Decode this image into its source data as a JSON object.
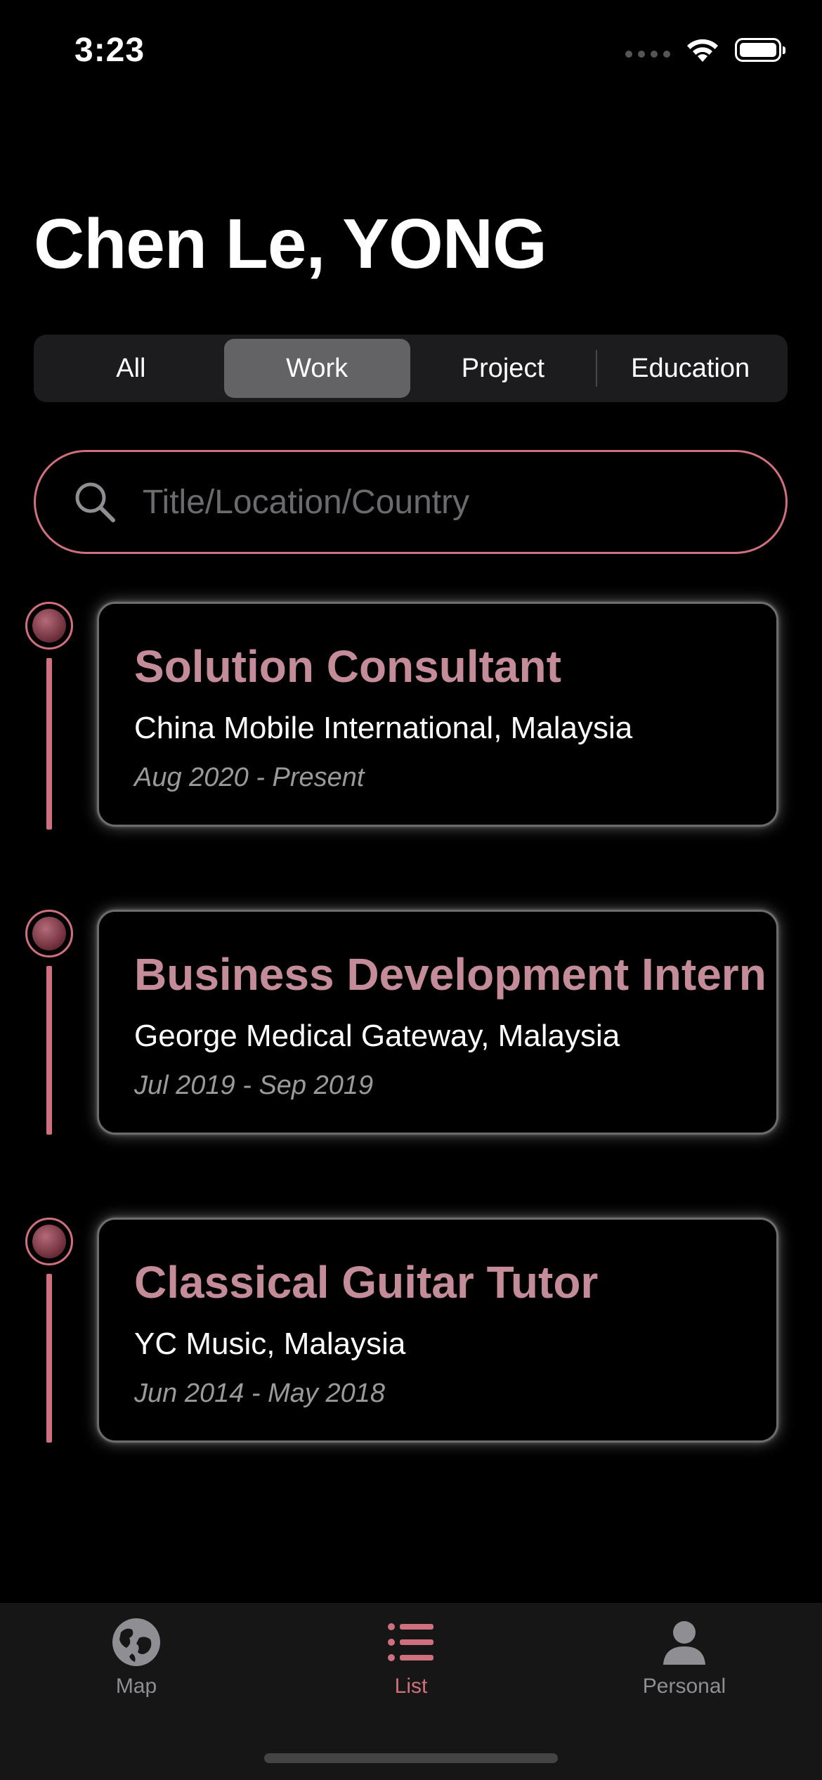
{
  "status_bar": {
    "time": "3:23"
  },
  "header": {
    "title": "Chen Le, YONG"
  },
  "segments": [
    {
      "label": "All",
      "selected": false
    },
    {
      "label": "Work",
      "selected": true
    },
    {
      "label": "Project",
      "selected": false
    },
    {
      "label": "Education",
      "selected": false
    }
  ],
  "search": {
    "placeholder": "Title/Location/Country",
    "value": ""
  },
  "entries": [
    {
      "title": "Solution Consultant",
      "organization": "China Mobile International, Malaysia",
      "dates": "Aug 2020 - Present"
    },
    {
      "title": "Business Development Intern",
      "organization": "George Medical Gateway, Malaysia",
      "dates": "Jul 2019 - Sep 2019"
    },
    {
      "title": "Classical Guitar Tutor",
      "organization": "YC Music, Malaysia",
      "dates": "Jun 2014 - May 2018"
    }
  ],
  "tabbar": {
    "items": [
      {
        "label": "Map",
        "icon": "globe-icon",
        "active": false
      },
      {
        "label": "List",
        "icon": "list-icon",
        "active": true
      },
      {
        "label": "Personal",
        "icon": "person-icon",
        "active": false
      }
    ]
  },
  "colors": {
    "accent": "#d0707e",
    "title_pink": "#c48b98",
    "background": "#000000"
  }
}
